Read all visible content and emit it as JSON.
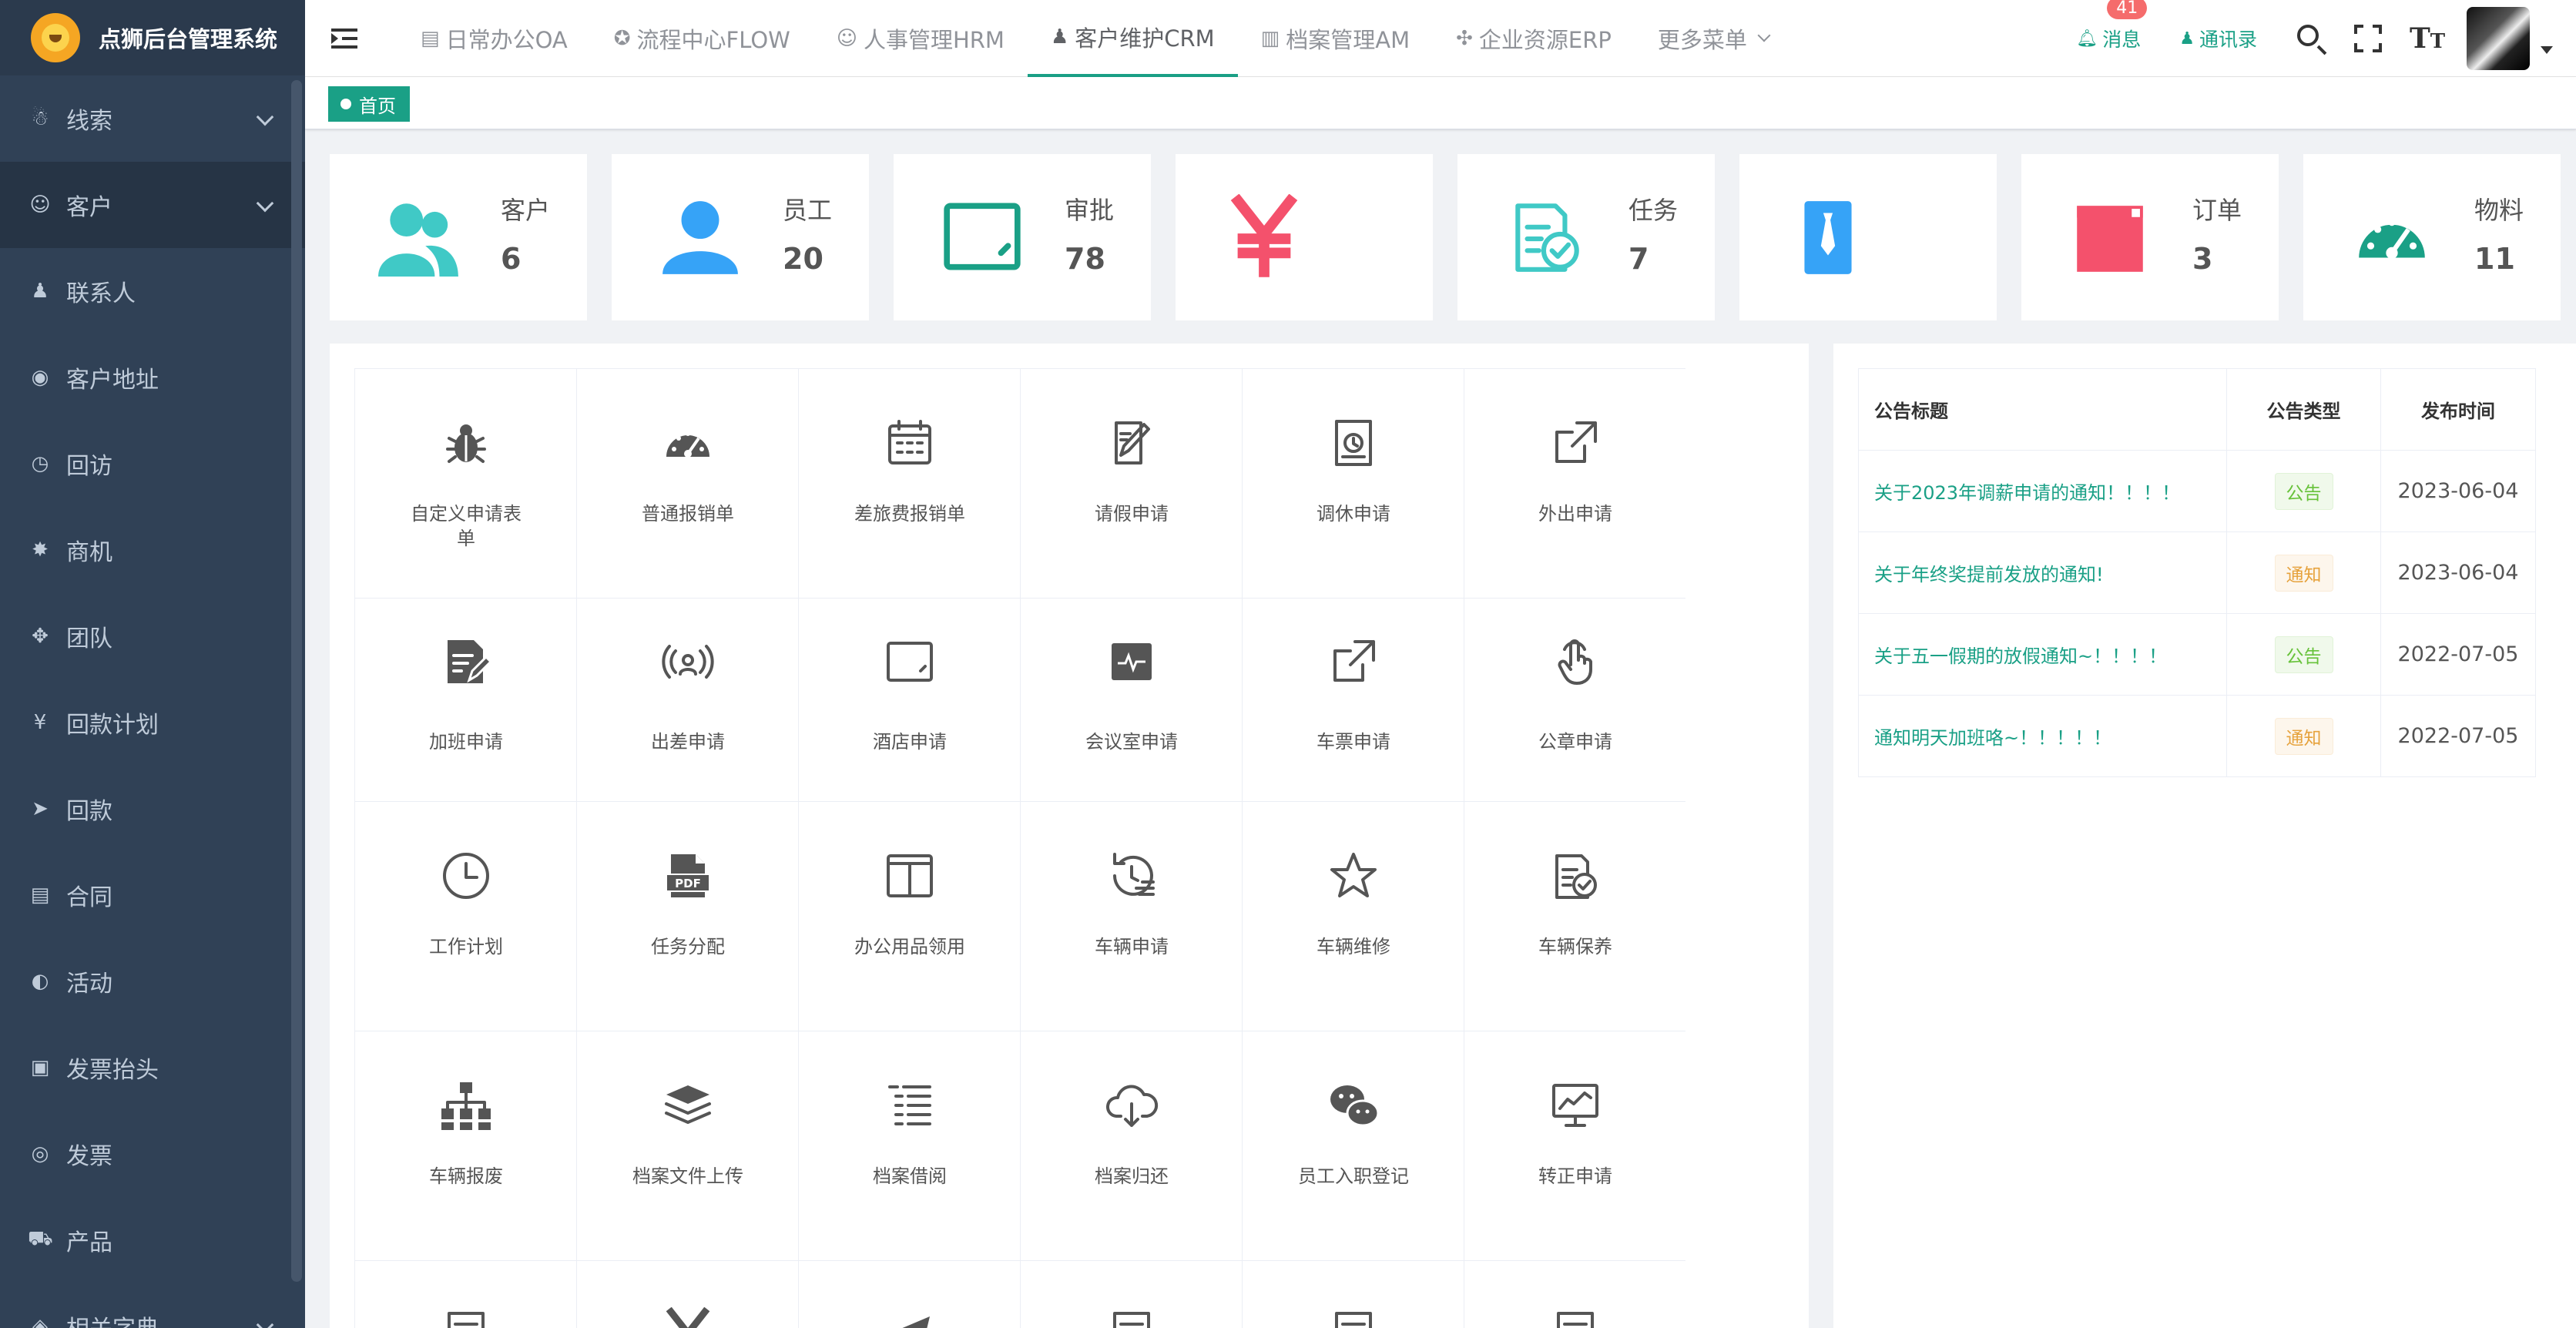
{
  "app": {
    "title": "点狮后台管理系统"
  },
  "sidebar": {
    "items": [
      {
        "label": "线索",
        "icon": "☃",
        "arrow": true
      },
      {
        "label": "客户",
        "icon": "☺",
        "arrow": true,
        "open": true
      },
      {
        "label": "联系人",
        "icon": "♟",
        "arrow": false
      },
      {
        "label": "客户地址",
        "icon": "◉",
        "arrow": false
      },
      {
        "label": "回访",
        "icon": "◷",
        "arrow": false
      },
      {
        "label": "商机",
        "icon": "✸",
        "arrow": false
      },
      {
        "label": "团队",
        "icon": "✥",
        "arrow": false
      },
      {
        "label": "回款计划",
        "icon": "¥",
        "arrow": false
      },
      {
        "label": "回款",
        "icon": "➤",
        "arrow": false
      },
      {
        "label": "合同",
        "icon": "▤",
        "arrow": false
      },
      {
        "label": "活动",
        "icon": "◐",
        "arrow": false
      },
      {
        "label": "发票抬头",
        "icon": "▣",
        "arrow": false
      },
      {
        "label": "发票",
        "icon": "◎",
        "arrow": false
      },
      {
        "label": "产品",
        "icon": "⛟",
        "arrow": false
      },
      {
        "label": "相关字典",
        "icon": "◈",
        "arrow": true
      }
    ]
  },
  "topnav": {
    "menus": [
      {
        "label": "日常办公OA",
        "icon": "▤"
      },
      {
        "label": "流程中心FLOW",
        "icon": "✪"
      },
      {
        "label": "人事管理HRM",
        "icon": "☺"
      },
      {
        "label": "客户维护CRM",
        "icon": "♟",
        "active": true
      },
      {
        "label": "档案管理AM",
        "icon": "▥"
      },
      {
        "label": "企业资源ERP",
        "icon": "✣"
      },
      {
        "label": "更多菜单",
        "icon": ""
      }
    ],
    "message_label": "消息",
    "message_badge": "41",
    "contacts_label": "通讯录"
  },
  "tags": {
    "home": "首页"
  },
  "stats": [
    {
      "label": "客户",
      "value": "6",
      "icon": "people-icon",
      "color": "#40c9c6"
    },
    {
      "label": "员工",
      "value": "20",
      "icon": "user-icon",
      "color": "#36a3f7"
    },
    {
      "label": "审批",
      "value": "78",
      "icon": "tablet-icon",
      "color": "#1aa086"
    },
    {
      "label": "",
      "value": "",
      "icon": "yen-icon",
      "color": "#f4516c"
    },
    {
      "label": "任务",
      "value": "7",
      "icon": "task-icon",
      "color": "#40c9c6"
    },
    {
      "label": "",
      "value": "",
      "icon": "tie-icon",
      "color": "#36a3f7"
    },
    {
      "label": "订单",
      "value": "3",
      "icon": "calendar-icon",
      "color": "#f4516c"
    },
    {
      "label": "物料",
      "value": "11",
      "icon": "dashboard-icon",
      "color": "#1aa086"
    }
  ],
  "apps": [
    {
      "label": "自定义申请表单",
      "icon": "bug-icon"
    },
    {
      "label": "普通报销单",
      "icon": "dashboard-icon"
    },
    {
      "label": "差旅费报销单",
      "icon": "calendar-icon"
    },
    {
      "label": "请假申请",
      "icon": "edit-icon"
    },
    {
      "label": "调休申请",
      "icon": "clock-doc-icon"
    },
    {
      "label": "外出申请",
      "icon": "external-link-icon"
    },
    {
      "label": "加班申请",
      "icon": "doc-edit-icon"
    },
    {
      "label": "出差申请",
      "icon": "broadcast-icon"
    },
    {
      "label": "酒店申请",
      "icon": "tablet-icon"
    },
    {
      "label": "会议室申请",
      "icon": "monitor-icon"
    },
    {
      "label": "车票申请",
      "icon": "external-link-icon"
    },
    {
      "label": "公章申请",
      "icon": "pointer-icon"
    },
    {
      "label": "工作计划",
      "icon": "clock-icon"
    },
    {
      "label": "任务分配",
      "icon": "pdf-icon"
    },
    {
      "label": "办公用品领用",
      "icon": "columns-icon"
    },
    {
      "label": "车辆申请",
      "icon": "history-icon"
    },
    {
      "label": "车辆维修",
      "icon": "star-icon"
    },
    {
      "label": "车辆保养",
      "icon": "task-icon"
    },
    {
      "label": "车辆报废",
      "icon": "tree-icon"
    },
    {
      "label": "档案文件上传",
      "icon": "stack-icon"
    },
    {
      "label": "档案借阅",
      "icon": "list-icon"
    },
    {
      "label": "档案归还",
      "icon": "cloud-download-icon"
    },
    {
      "label": "员工入职登记",
      "icon": "wechat-icon"
    },
    {
      "label": "转正申请",
      "icon": "chart-monitor-icon"
    },
    {
      "label": "",
      "icon": "doc-icon"
    },
    {
      "label": "",
      "icon": "yen-icon"
    },
    {
      "label": "",
      "icon": "send-icon"
    },
    {
      "label": "",
      "icon": "doc-icon"
    },
    {
      "label": "",
      "icon": "doc-icon"
    },
    {
      "label": "",
      "icon": "doc-icon"
    }
  ],
  "notices": {
    "headers": {
      "title": "公告标题",
      "type": "公告类型",
      "date": "发布时间"
    },
    "rows": [
      {
        "title": "关于2023年调薪申请的通知！！！！",
        "type": "公告",
        "type_color": "green",
        "date": "2023-06-04"
      },
      {
        "title": "关于年终奖提前发放的通知!",
        "type": "通知",
        "type_color": "orange",
        "date": "2023-06-04"
      },
      {
        "title": "关于五一假期的放假通知~！！！！",
        "type": "公告",
        "type_color": "green",
        "date": "2022-07-05"
      },
      {
        "title": "通知明天加班咯~！！！！！",
        "type": "通知",
        "type_color": "orange",
        "date": "2022-07-05"
      }
    ]
  },
  "colors": {
    "accent": "#1aa086",
    "sidebar": "#304156",
    "badge": "#f56c6c"
  }
}
